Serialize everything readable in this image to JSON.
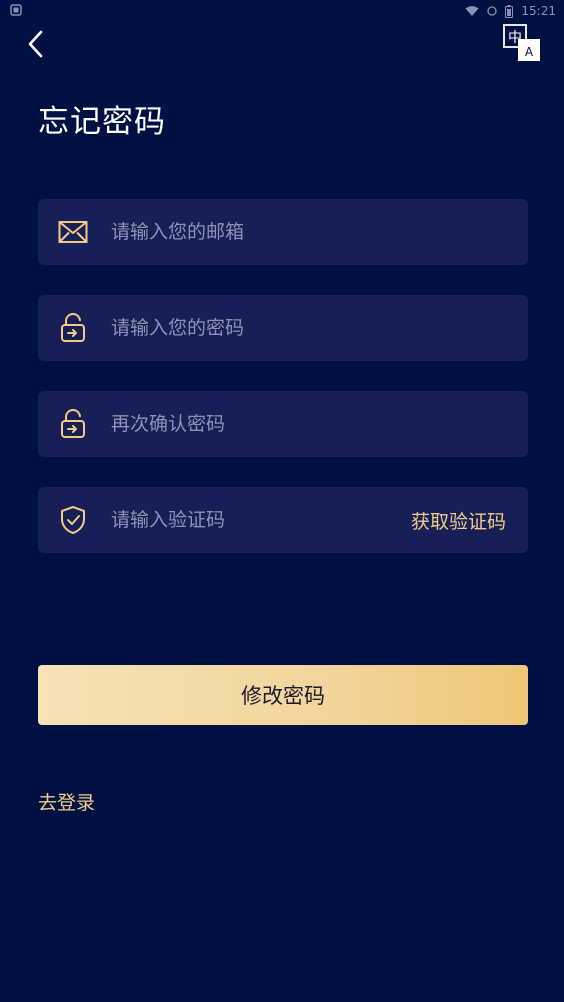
{
  "status_bar": {
    "time": "15:21"
  },
  "title": "忘记密码",
  "language_icon": {
    "top": "中",
    "bottom": "A"
  },
  "fields": {
    "email": {
      "placeholder": "请输入您的邮箱",
      "value": ""
    },
    "password": {
      "placeholder": "请输入您的密码",
      "value": ""
    },
    "confirm_password": {
      "placeholder": "再次确认密码",
      "value": ""
    },
    "code": {
      "placeholder": "请输入验证码",
      "value": ""
    }
  },
  "get_code_label": "获取验证码",
  "submit_label": "修改密码",
  "login_link": "去登录",
  "colors": {
    "background": "#011043",
    "field_bg": "#171f57",
    "accent": "#f2cc86"
  }
}
